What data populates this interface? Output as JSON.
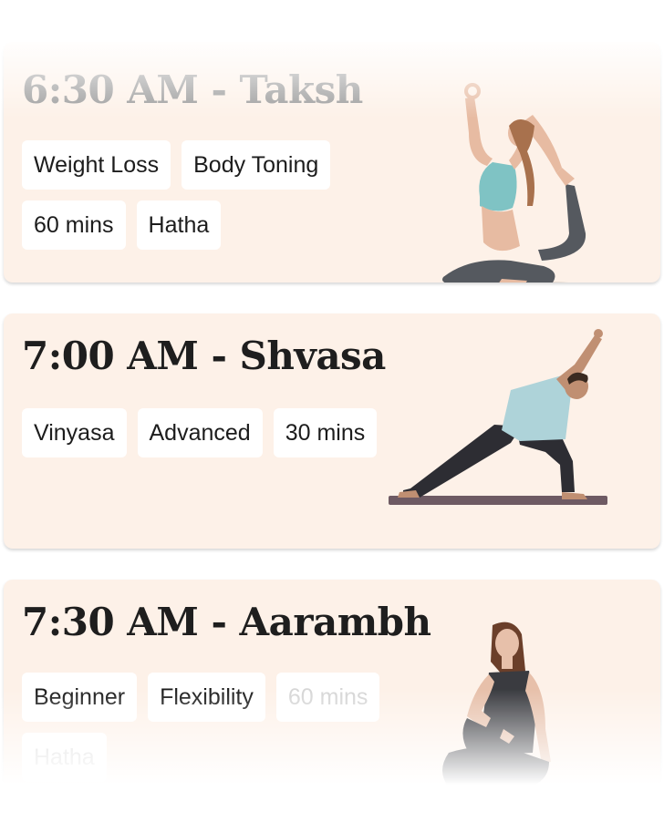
{
  "classes": [
    {
      "title": "6:30 AM - Taksh",
      "tags": [
        "Weight Loss",
        "Body Toning",
        "60 mins",
        "Hatha"
      ],
      "image": "yoga-king-pigeon-pose-image"
    },
    {
      "title": "7:00 AM - Shvasa",
      "tags": [
        "Vinyasa",
        "Advanced",
        "30 mins"
      ],
      "image": "yoga-side-angle-pose-image"
    },
    {
      "title": "7:30 AM - Aarambh",
      "tags": [
        "Beginner",
        "Flexibility",
        "60 mins",
        "Hatha"
      ],
      "image": "yoga-seated-pose-image"
    }
  ],
  "colors": {
    "card_background": "#fdf1e8",
    "tag_background": "#ffffff",
    "title_text": "#1e1e1e"
  }
}
